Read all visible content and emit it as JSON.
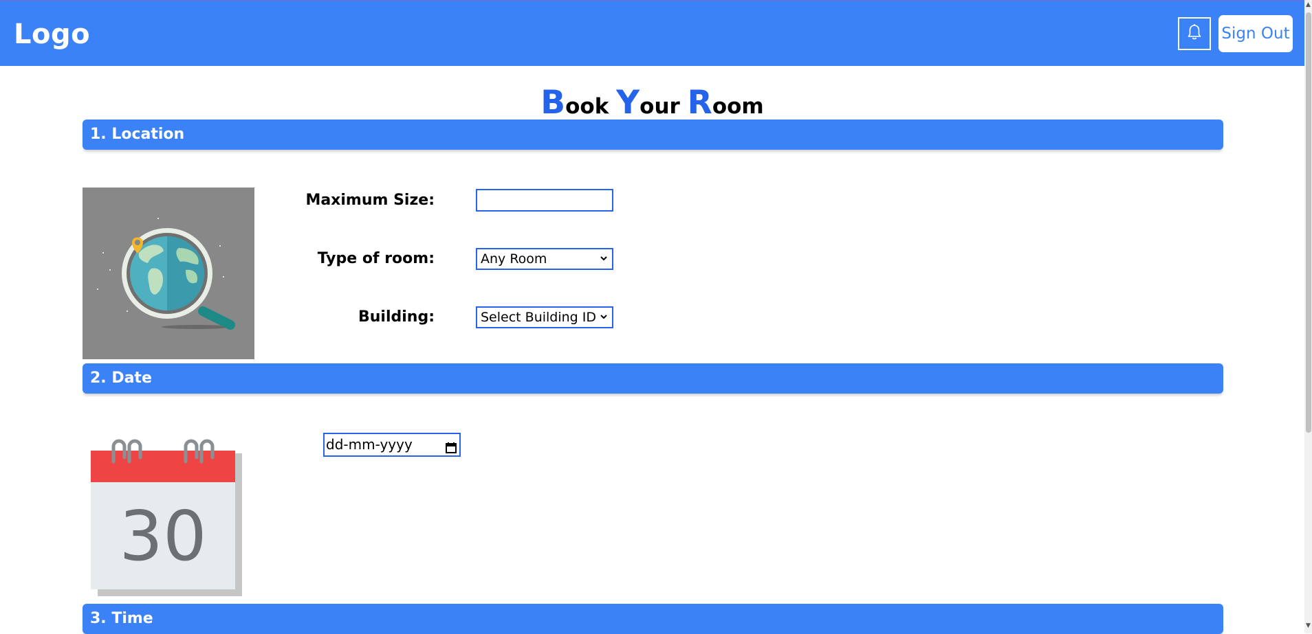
{
  "header": {
    "logo": "Logo",
    "sign_out_label": "Sign Out",
    "notification_icon": "bell-icon"
  },
  "page": {
    "title_parts": [
      {
        "big": "B",
        "rest": "ook "
      },
      {
        "big": "Y",
        "rest": "our "
      },
      {
        "big": "R",
        "rest": "oom"
      }
    ]
  },
  "sections": {
    "location": {
      "heading": "1. Location",
      "image": "globe-magnifier-illustration",
      "max_size_label": "Maximum Size:",
      "max_size_value": "",
      "room_type_label": "Type of room:",
      "room_type_selected": "Any Room",
      "building_label": "Building:",
      "building_selected": "Select Building ID"
    },
    "date": {
      "heading": "2. Date",
      "image": "calendar-illustration",
      "calendar_day": "30",
      "date_placeholder": "dd-mm-yyyy"
    },
    "time": {
      "heading": "3. Time"
    }
  },
  "colors": {
    "primary": "#3b82f6",
    "accent_text": "#2563eb",
    "image_bg": "#888888",
    "calendar_red": "#ef4444"
  }
}
